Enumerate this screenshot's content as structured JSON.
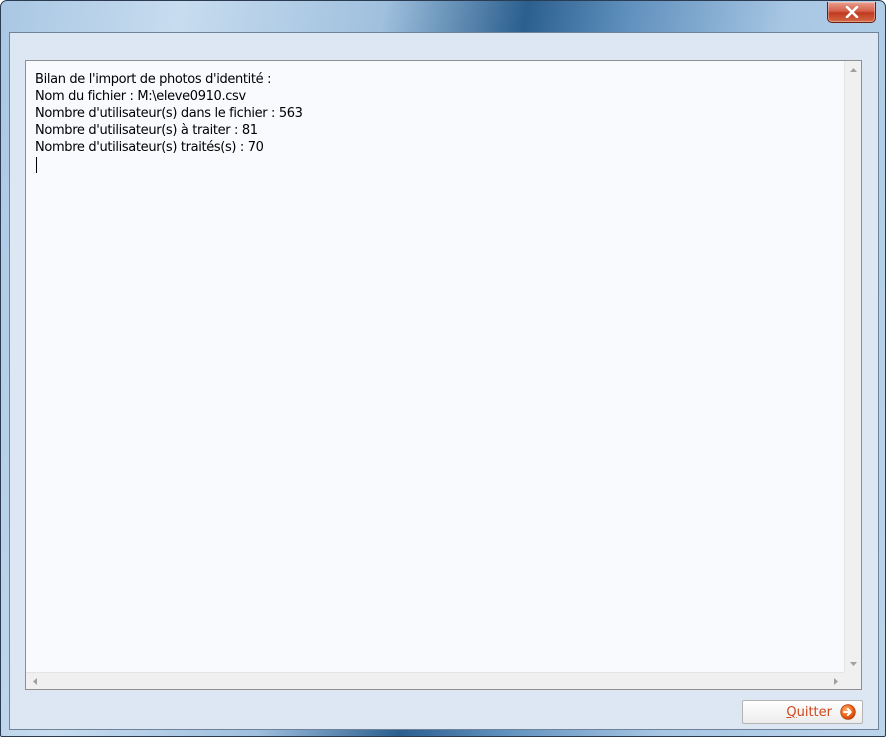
{
  "window": {
    "close_tooltip_icon": "close-icon"
  },
  "report": {
    "lines": [
      "Bilan de l'import de photos d'identité :",
      "Nom du fichier : M:\\eleve0910.csv",
      "Nombre d'utilisateur(s) dans le fichier : 563",
      "Nombre d'utilisateur(s) à traiter : 81",
      "Nombre d'utilisateur(s) traités(s) : 70"
    ]
  },
  "footer": {
    "quit_mnemonic": "Q",
    "quit_rest": "uitter",
    "quit_icon": "arrow-right-circle-icon",
    "quit_color": "#d2471c"
  },
  "colors": {
    "close_button": "#c7432a",
    "client_background": "#dce7f3",
    "text_background": "#f9fafe"
  }
}
